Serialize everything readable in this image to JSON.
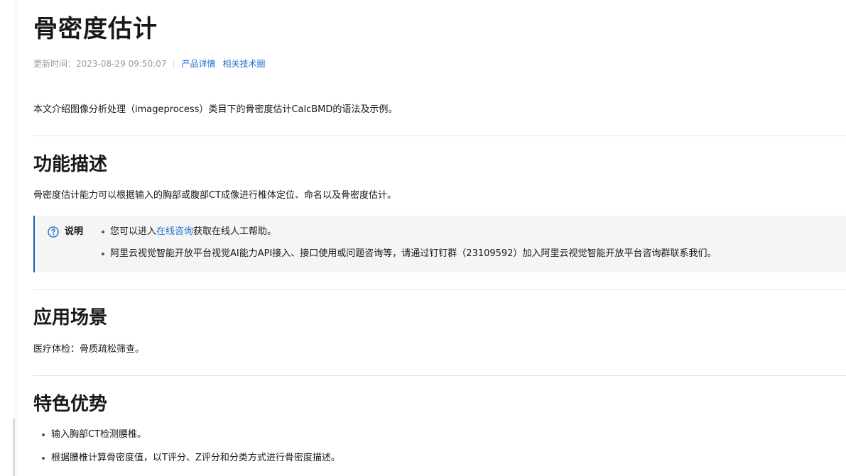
{
  "doc": {
    "title": "骨密度估计",
    "meta": {
      "updated_label": "更新时间：",
      "updated_value": "2023-08-29 09:50:07",
      "links": [
        "产品详情",
        "相关技术圈"
      ]
    },
    "intro": "本文介绍图像分析处理（imageprocess）类目下的骨密度估计CalcBMD的语法及示例。"
  },
  "sections": {
    "function": {
      "title": "功能描述",
      "text": "骨密度估计能力可以根据输入的胸部或腹部CT成像进行椎体定位、命名以及骨密度估计。"
    },
    "note": {
      "icon": "help-circle-icon",
      "label": "说明",
      "item1_prefix": "您可以进入",
      "item1_link": "在线咨询",
      "item1_suffix": "获取在线人工帮助。",
      "item2": "阿里云视觉智能开放平台视觉AI能力API接入、接口使用或问题咨询等，请通过钉钉群（23109592）加入阿里云视觉智能开放平台咨询群联系我们。"
    },
    "scenario": {
      "title": "应用场景",
      "text": "医疗体检：骨质疏松筛查。"
    },
    "advantages": {
      "title": "特色优势",
      "items": [
        "输入胸部CT检测腰椎。",
        "根据腰椎计算骨密度值，以T评分、Z评分和分类方式进行骨密度描述。"
      ]
    }
  },
  "colors": {
    "link": "#1f6fd1",
    "note_border": "#1f5fb8",
    "note_bg": "#f5f5f5"
  }
}
